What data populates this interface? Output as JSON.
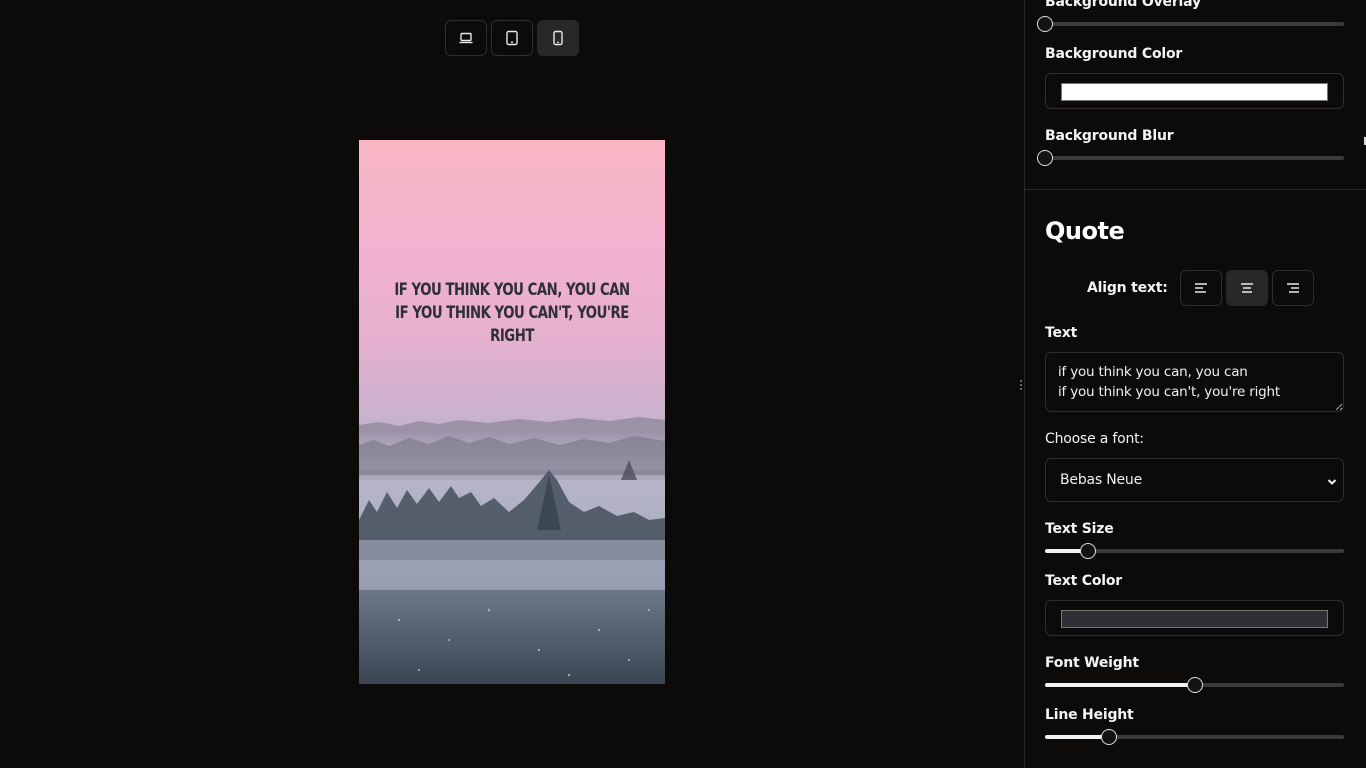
{
  "device_toggle": {
    "buttons": [
      {
        "icon": "laptop-icon",
        "active": false
      },
      {
        "icon": "tablet-icon",
        "active": false
      },
      {
        "icon": "phone-icon",
        "active": true
      }
    ]
  },
  "preview": {
    "quote_lines": [
      "if you think you can, you can",
      "if you think you can't, you're right"
    ],
    "text_color": "#2f2f36",
    "background": "pink-sky-misty-forest-photo"
  },
  "panel": {
    "background_overlay": {
      "label": "Background Overlay",
      "value": 0.0
    },
    "background_color": {
      "label": "Background Color",
      "color": "#ffffff"
    },
    "background_blur": {
      "label": "Background Blur",
      "value": 0.0
    },
    "section_title": "Quote",
    "align": {
      "label": "Align text:",
      "options": [
        {
          "icon": "align-left-icon",
          "active": false
        },
        {
          "icon": "align-center-icon",
          "active": true
        },
        {
          "icon": "align-right-icon",
          "active": false
        }
      ]
    },
    "text": {
      "label": "Text",
      "value": "if you think you can, you can\nif you think you can't, you're right"
    },
    "font": {
      "label": "Choose a font:",
      "selected": "Bebas Neue"
    },
    "text_size": {
      "label": "Text Size",
      "value": 0.145
    },
    "text_color": {
      "label": "Text Color",
      "color": "#2f2f36"
    },
    "font_weight": {
      "label": "Font Weight",
      "value": 0.5
    },
    "line_height": {
      "label": "Line Height",
      "value": 0.215
    }
  }
}
